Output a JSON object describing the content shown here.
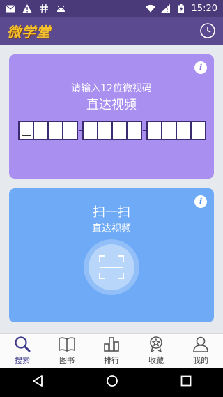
{
  "status_bar": {
    "time": "15:20",
    "icons": [
      "mail-icon",
      "warning-icon",
      "hash-icon",
      "android-icon",
      "wifi-icon",
      "signal-icon",
      "battery-icon"
    ]
  },
  "app_bar": {
    "logo_text": "微学堂",
    "history_icon": "history-icon"
  },
  "code_card": {
    "prompt": "请输入12位微视码",
    "headline": "直达视频",
    "groups": [
      4,
      4,
      4
    ],
    "info_icon": "info-icon"
  },
  "scan_card": {
    "title": "扫一扫",
    "subtitle": "直达视频",
    "scan_icon": "scan-frame-icon",
    "info_icon": "info-icon"
  },
  "tabs": [
    {
      "label": "搜索",
      "icon": "search-icon",
      "active": true
    },
    {
      "label": "图书",
      "icon": "book-icon",
      "active": false
    },
    {
      "label": "排行",
      "icon": "ranking-icon",
      "active": false
    },
    {
      "label": "收藏",
      "icon": "favorite-badge-icon",
      "active": false
    },
    {
      "label": "我的",
      "icon": "profile-icon",
      "active": false
    }
  ],
  "colors": {
    "status_bar": "#4a3a7a",
    "app_bar": "#5b4a8f",
    "logo": "#f3c22e",
    "code_card": "#a88ff0",
    "scan_card": "#6eaaf5",
    "active_tab": "#3e3a8a"
  }
}
